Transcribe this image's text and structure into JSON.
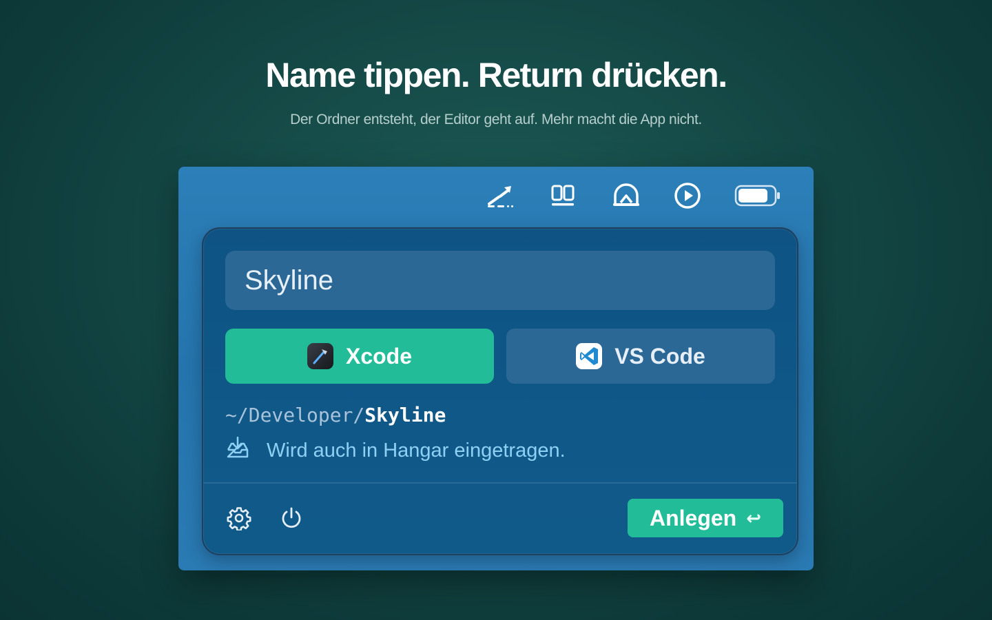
{
  "hero": {
    "title": "Name tippen. Return drücken.",
    "subtitle": "Der Ordner entsteht, der Editor geht auf. Mehr macht die App nicht."
  },
  "menubar": {
    "icons": [
      "launch-ramp-icon",
      "split-view-icon",
      "hangar-icon",
      "play-circle-icon",
      "battery-icon"
    ]
  },
  "popover": {
    "name_field": {
      "value": "Skyline"
    },
    "editors": [
      {
        "label": "Xcode",
        "icon": "xcode-icon",
        "selected": true
      },
      {
        "label": "VS Code",
        "icon": "vscode-icon",
        "selected": false
      }
    ],
    "path": {
      "prefix": "~/Developer/",
      "name": "Skyline"
    },
    "info": {
      "text": "Wird auch in Hangar eingetragen.",
      "icon": "tray-download-icon"
    },
    "footer": {
      "settings_icon": "gear-icon",
      "power_icon": "power-icon",
      "create_label": "Anlegen",
      "create_shortcut": "↩"
    }
  },
  "colors": {
    "accent": "#22bd98",
    "screen_bg": "#2a7ab3",
    "popover_bg": "#0f5888",
    "field_bg": "#2b6896",
    "info_text": "#8fd0f5"
  }
}
